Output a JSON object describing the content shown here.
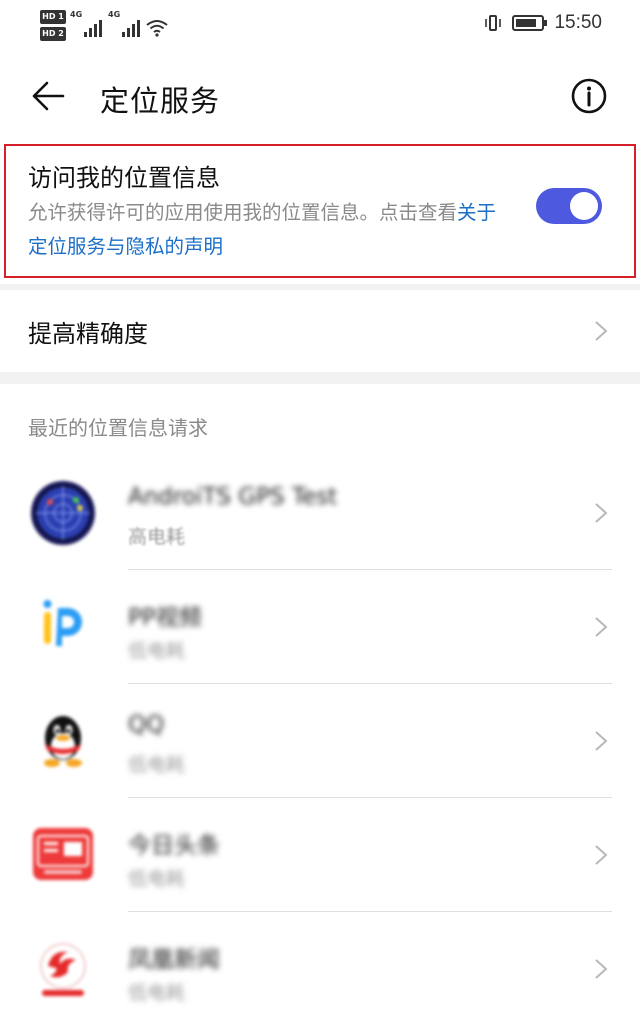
{
  "status_bar": {
    "sim1": "HD 1",
    "sim2": "HD 2",
    "signal1_label": "4G",
    "signal2_label": "4G",
    "time": "15:50"
  },
  "app_bar": {
    "title": "定位服务"
  },
  "location_toggle": {
    "title": "访问我的位置信息",
    "description": "允许获得许可的应用使用我的位置信息。点击查看",
    "link": "关于定位服务与隐私的声明",
    "enabled": true,
    "accent": "#4d5ae0",
    "link_color": "#1b6fc7",
    "highlight_color": "#d61f26"
  },
  "accuracy": {
    "label": "提高精确度"
  },
  "recent": {
    "header": "最近的位置信息请求",
    "items": [
      {
        "name": "AndroiTS GPS Test",
        "usage": "高电耗",
        "icon": "gps-radar-icon"
      },
      {
        "name": "PP视频",
        "usage": "低电耗",
        "icon": "pp-video-icon"
      },
      {
        "name": "QQ",
        "usage": "低电耗",
        "icon": "qq-penguin-icon"
      },
      {
        "name": "今日头条",
        "usage": "低电耗",
        "icon": "toutiao-icon"
      },
      {
        "name": "凤凰新闻",
        "usage": "低电耗",
        "icon": "ifeng-news-icon"
      }
    ]
  }
}
